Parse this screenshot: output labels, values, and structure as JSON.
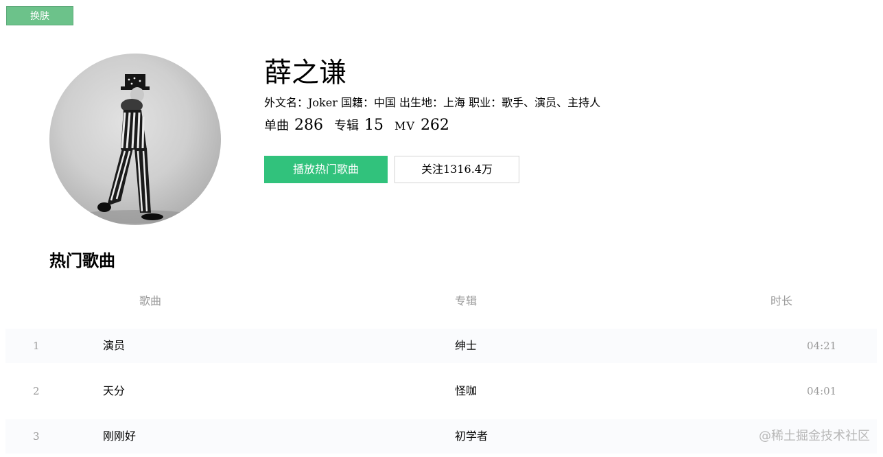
{
  "toolbar": {
    "skin_label": "换肤"
  },
  "artist": {
    "name": "薛之谦",
    "info": "外文名：Joker 国籍：中国 出生地：上海 职业：歌手、演员、主持人",
    "stats": {
      "songs_label": "单曲",
      "songs_value": "286",
      "albums_label": "专辑",
      "albums_value": "15",
      "mv_label": "MV",
      "mv_value": "262"
    },
    "play_label": "播放热门歌曲",
    "follow_label": "关注1316.4万"
  },
  "hot_songs": {
    "title": "热门歌曲",
    "columns": {
      "song": "歌曲",
      "album": "专辑",
      "duration": "时长"
    },
    "rows": [
      {
        "index": "1",
        "name": "演员",
        "album": "绅士",
        "duration": "04:21"
      },
      {
        "index": "2",
        "name": "天分",
        "album": "怪咖",
        "duration": "04:01"
      },
      {
        "index": "3",
        "name": "刚刚好",
        "album": "初学者",
        "duration": ""
      }
    ]
  },
  "watermark": "@稀土掘金技术社区"
}
